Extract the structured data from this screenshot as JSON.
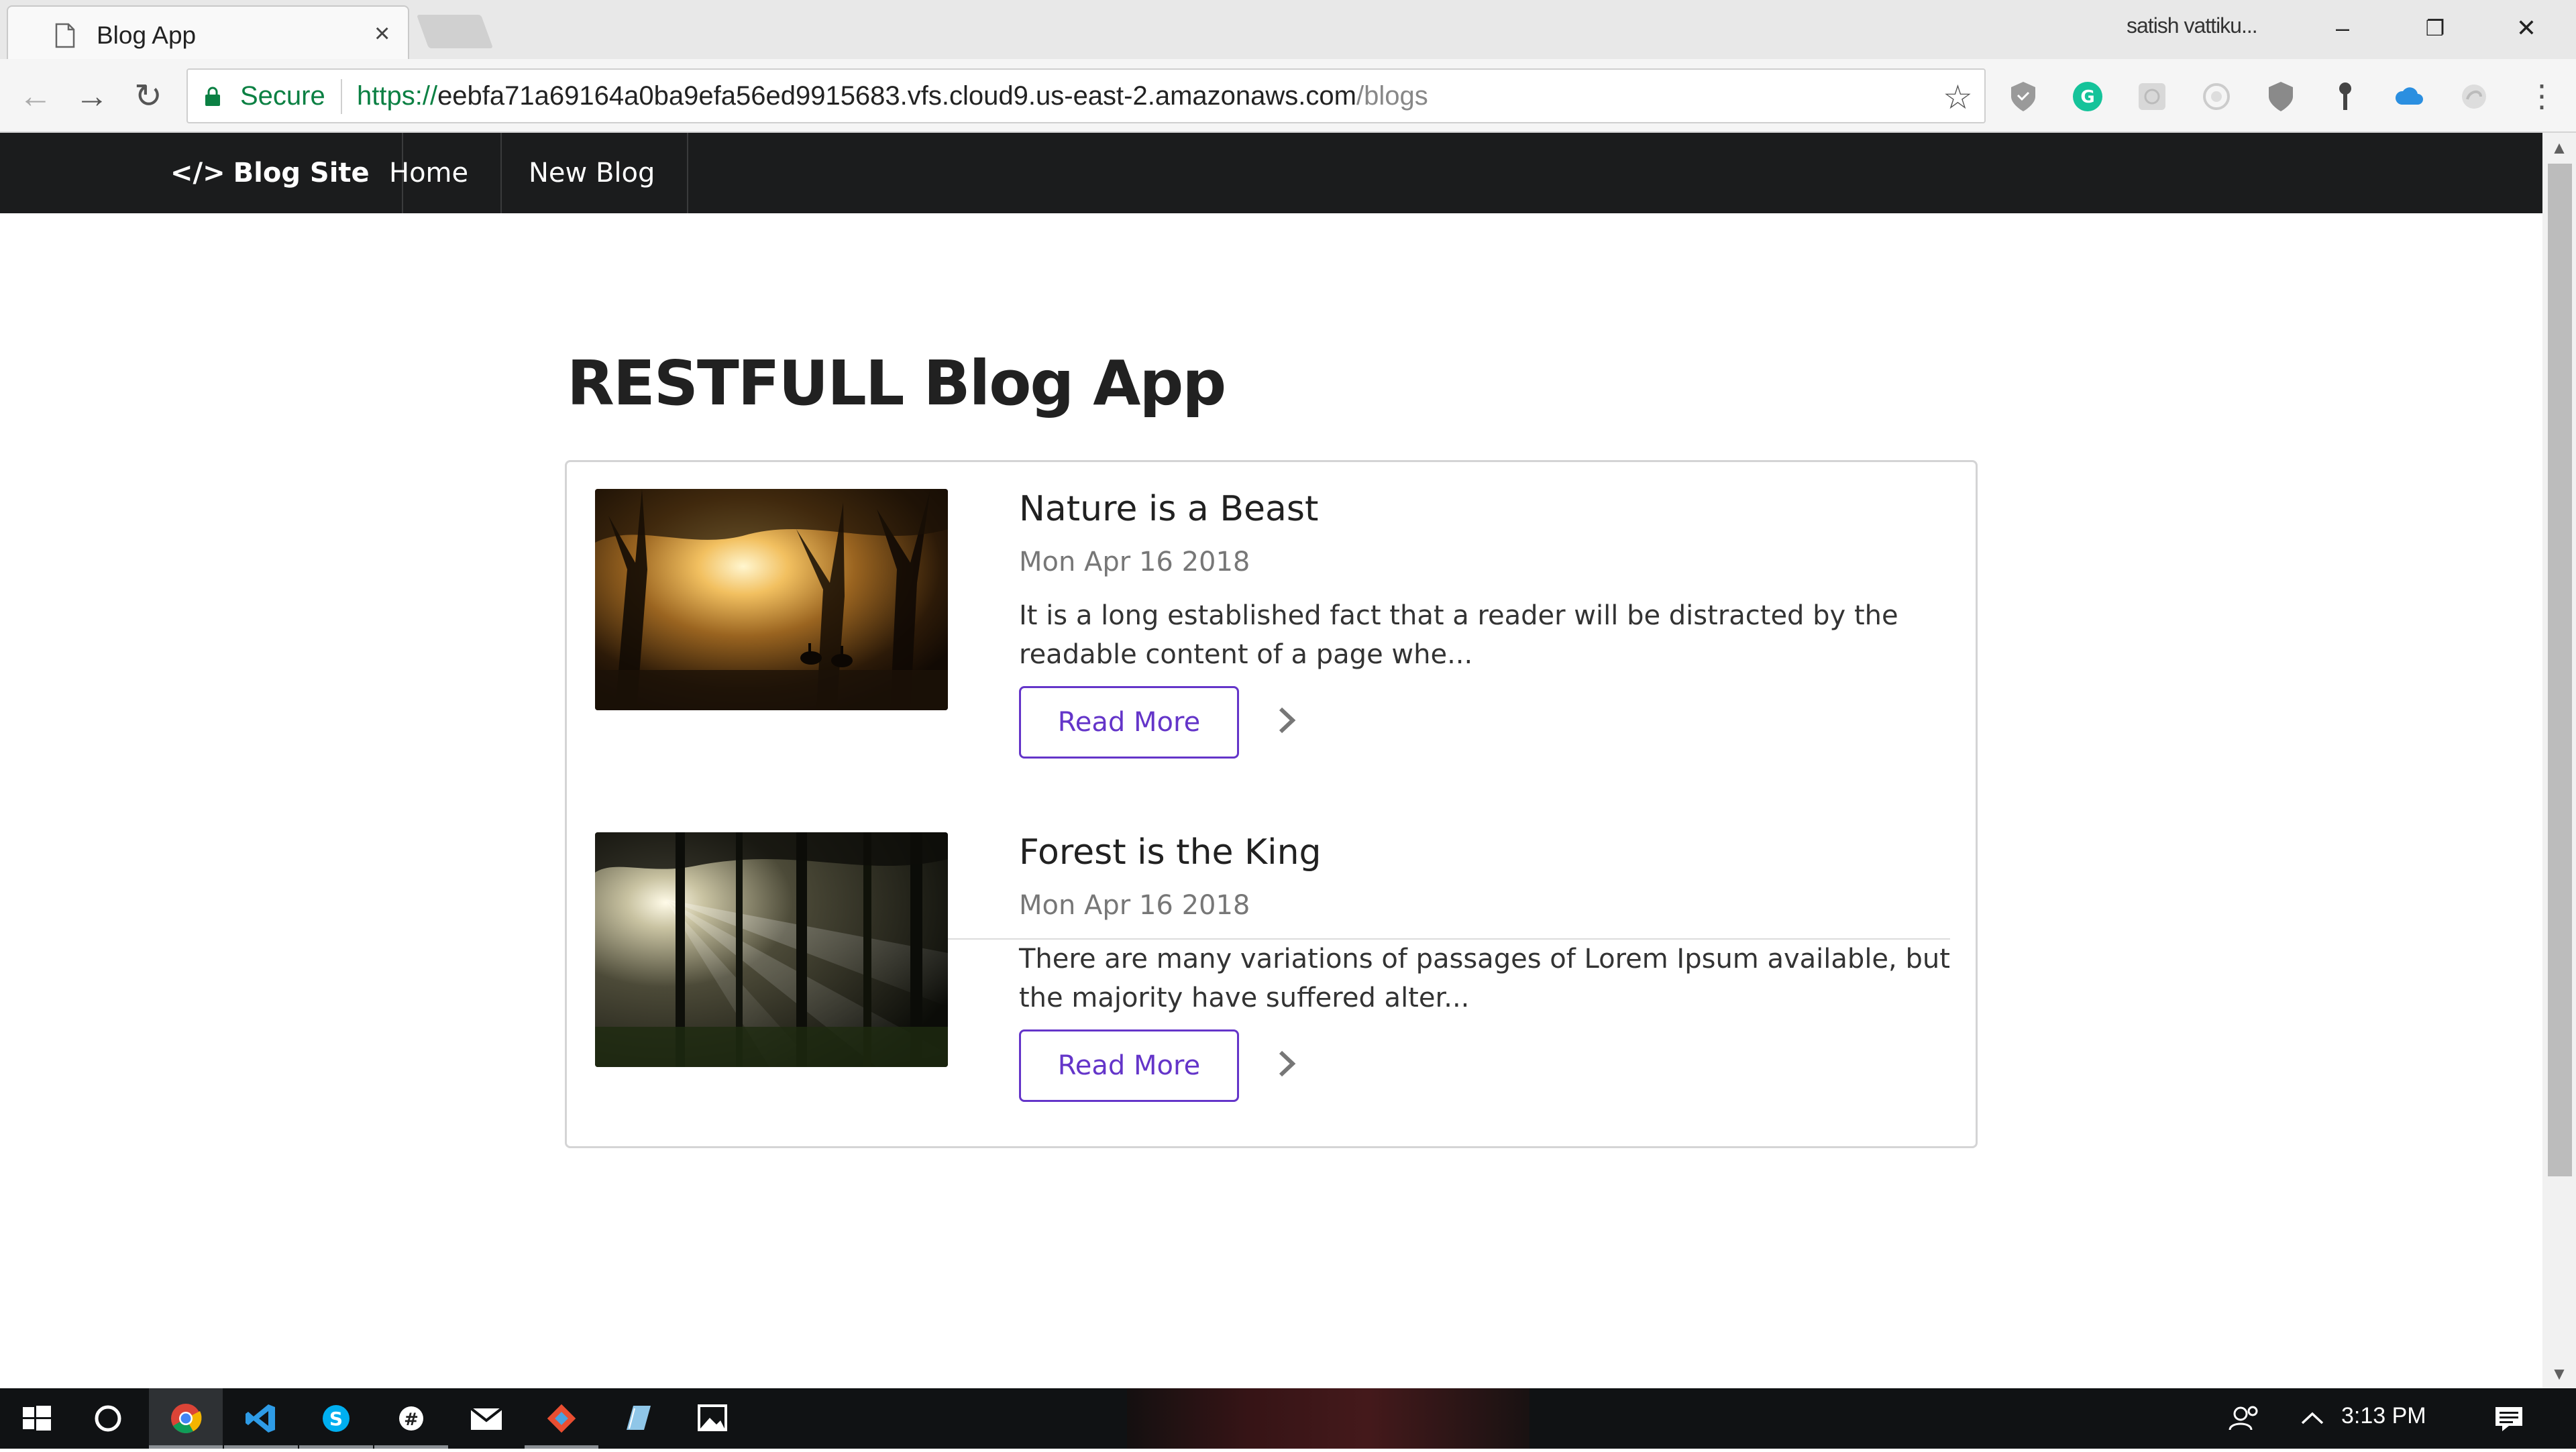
{
  "browser": {
    "tab_title": "Blog App",
    "tab_close": "×",
    "profile_name": "satish vattiku...",
    "window_controls": {
      "minimize": "–",
      "restore": "❐",
      "close": "✕"
    },
    "nav": {
      "back": "←",
      "forward": "→",
      "reload": "↻"
    },
    "secure_label": "Secure",
    "url": {
      "scheme": "https://",
      "host": "eebfa71a69164a0ba9efa56ed9915683.vfs.cloud9.us-east-2.amazonaws.com",
      "path": "/blogs"
    },
    "bookmark_icon": "☆",
    "extensions": [
      "shield-icon",
      "grammarly-icon",
      "extension-gray-icon",
      "extension-circle-icon",
      "shield-gray-icon",
      "key-icon",
      "cloud-icon",
      "extension-swirl-icon"
    ],
    "menu_icon": "⋮"
  },
  "site_nav": {
    "brand_icon": "</>",
    "brand": "Blog Site",
    "items": [
      "Home",
      "New Blog"
    ]
  },
  "page": {
    "heading": "RESTFULL Blog App",
    "blogs": [
      {
        "title": "Nature is a Beast",
        "date": "Mon Apr 16 2018",
        "excerpt": "It is a long established fact that a reader will be distracted by the readable content of a page whe...",
        "button": "Read More"
      },
      {
        "title": "Forest is the King",
        "date": "Mon Apr 16 2018",
        "excerpt": "There are many variations of passages of Lorem Ipsum available, but the majority have suffered alter...",
        "button": "Read More"
      }
    ]
  },
  "taskbar": {
    "apps": [
      "windows-start-icon",
      "cortana-icon",
      "chrome-icon",
      "vscode-icon",
      "skype-icon",
      "slack-icon",
      "mail-icon",
      "git-icon",
      "notepad-icon",
      "photos-icon"
    ],
    "clock": "3:13 PM"
  },
  "colors": {
    "accent": "#6435c9",
    "nav_bg": "#1b1c1d",
    "secure_green": "#0b8043"
  }
}
